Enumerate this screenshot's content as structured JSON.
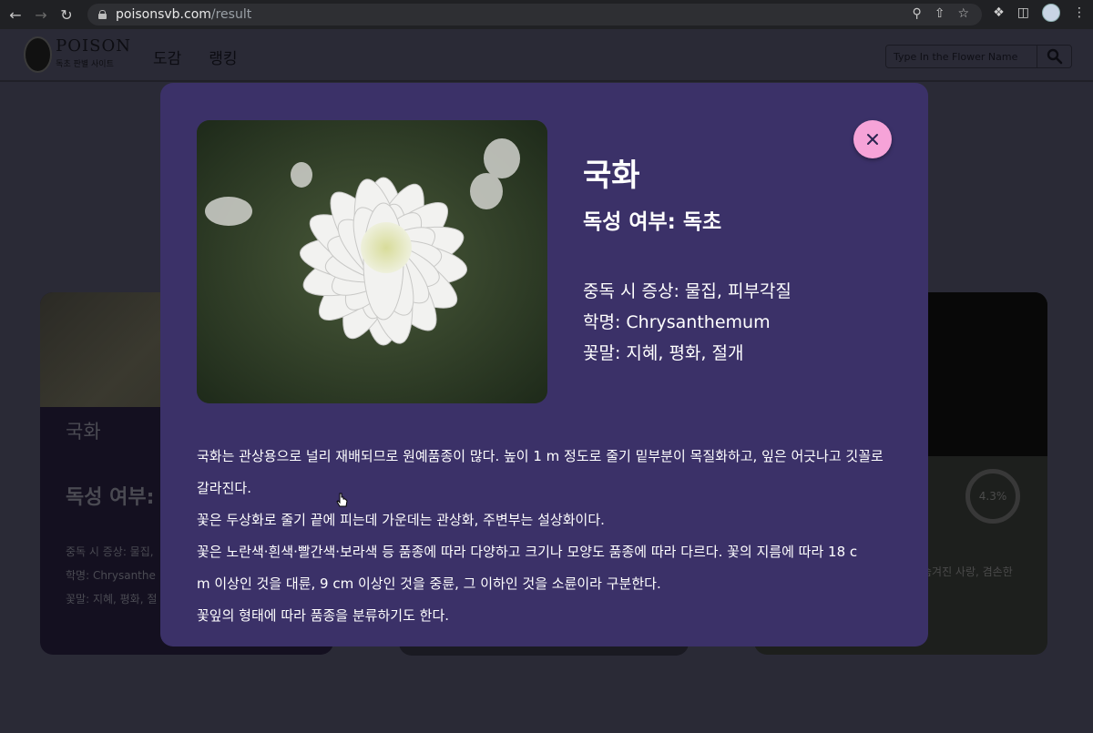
{
  "browser": {
    "url_host": "poisonsvb.com",
    "url_path": "/result"
  },
  "header": {
    "logo_title": "POISON",
    "logo_subtitle": "독초 판별 사이트",
    "nav": [
      "도감",
      "랭킹"
    ],
    "search_placeholder": "Type In the Flower Name"
  },
  "modal": {
    "title": "국화",
    "toxicity": "독성 여부: 독초",
    "details": [
      "중독 시 증상: 물집, 피부각질",
      "학명: Chrysanthemum",
      "꽃말: 지혜, 평화, 절개"
    ],
    "description": [
      "국화는 관상용으로 널리 재배되므로 원예품종이 많다. 높이 1 m 정도로 줄기 밑부분이 목질화하고, 잎은 어긋나고 깃꼴로",
      "갈라진다.",
      "꽃은 두상화로 줄기 끝에 피는데 가운데는 관상화, 주변부는 설상화이다.",
      "꽃은 노란색·흰색·빨간색·보라색 등 품종에 따라 다양하고 크기나 모양도 품종에 따라 다르다. 꽃의 지름에 따라 18 c",
      "m 이상인 것을 대륜, 9 cm 이상인 것을 중륜, 그 이하인 것을 소륜이라 구분한다.",
      "꽃잎의 형태에 따라 품종을 분류하기도 한다."
    ]
  },
  "background_cards": {
    "left": {
      "name": "국화",
      "toxicity": "독성 여부: 독",
      "info": [
        "중독 시 증상: 물집,",
        "학명: Chrysanthe",
        "꽃말: 지혜, 평화, 절"
      ]
    },
    "right": {
      "percent": "4.3%",
      "meaning": "숨겨진 사랑, 겸손한"
    }
  },
  "colors": {
    "modal_bg": "#3b3168",
    "close_button": "#f6a3d8"
  }
}
